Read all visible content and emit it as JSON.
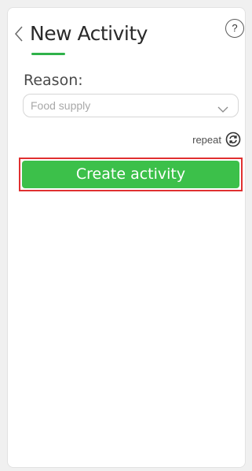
{
  "header": {
    "title": "New Activity",
    "help_label": "?"
  },
  "form": {
    "reason_label": "Reason:",
    "reason_value": "Food supply",
    "repeat_label": "repeat"
  },
  "actions": {
    "create_label": "Create activity"
  },
  "colors": {
    "accent_green": "#3cc04a",
    "underline_green": "#2fb24a",
    "highlight_red": "#e03030"
  },
  "icons": {
    "back": "chevron-left-icon",
    "help": "question-mark-icon",
    "dropdown": "chevron-down-icon",
    "repeat": "refresh-icon"
  }
}
